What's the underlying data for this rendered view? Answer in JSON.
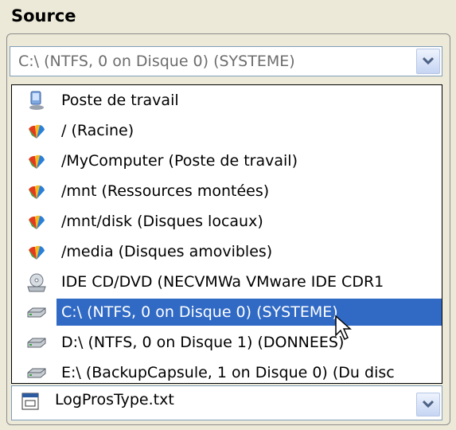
{
  "section_title": "Source",
  "source_combo": {
    "value": "C:\\  (NTFS, 0 on Disque 0) (SYSTEME)",
    "button_icon": "chevron-down-icon"
  },
  "dropdown_items": [
    {
      "label": "Poste de travail",
      "icon": "computer-icon"
    },
    {
      "label": "/ (Racine)",
      "icon": "folder-fan-icon"
    },
    {
      "label": "/MyComputer (Poste de travail)",
      "icon": "folder-fan-icon"
    },
    {
      "label": "/mnt (Ressources montées)",
      "icon": "folder-fan-icon"
    },
    {
      "label": "/mnt/disk (Disques locaux)",
      "icon": "folder-fan-icon"
    },
    {
      "label": "/media (Disques amovibles)",
      "icon": "folder-fan-icon"
    },
    {
      "label": "IDE CD/DVD (NECVMWa VMware IDE CDR1",
      "icon": "cd-drive-icon"
    },
    {
      "label": "C:\\  (NTFS, 0 on Disque 0) (SYSTEME)",
      "icon": "hard-drive-icon",
      "selected": true
    },
    {
      "label": "D:\\  (NTFS, 0 on Disque 1) (DONNEES)",
      "icon": "hard-drive-icon"
    },
    {
      "label": "E:\\  (BackupCapsule, 1 on Disque 0) (Du disc",
      "icon": "hard-drive-icon"
    }
  ],
  "file_combo": {
    "value": "LogProsType.txt",
    "icon": "text-file-icon"
  },
  "colors": {
    "selection": "#316ac5",
    "background": "#ece9d8"
  }
}
